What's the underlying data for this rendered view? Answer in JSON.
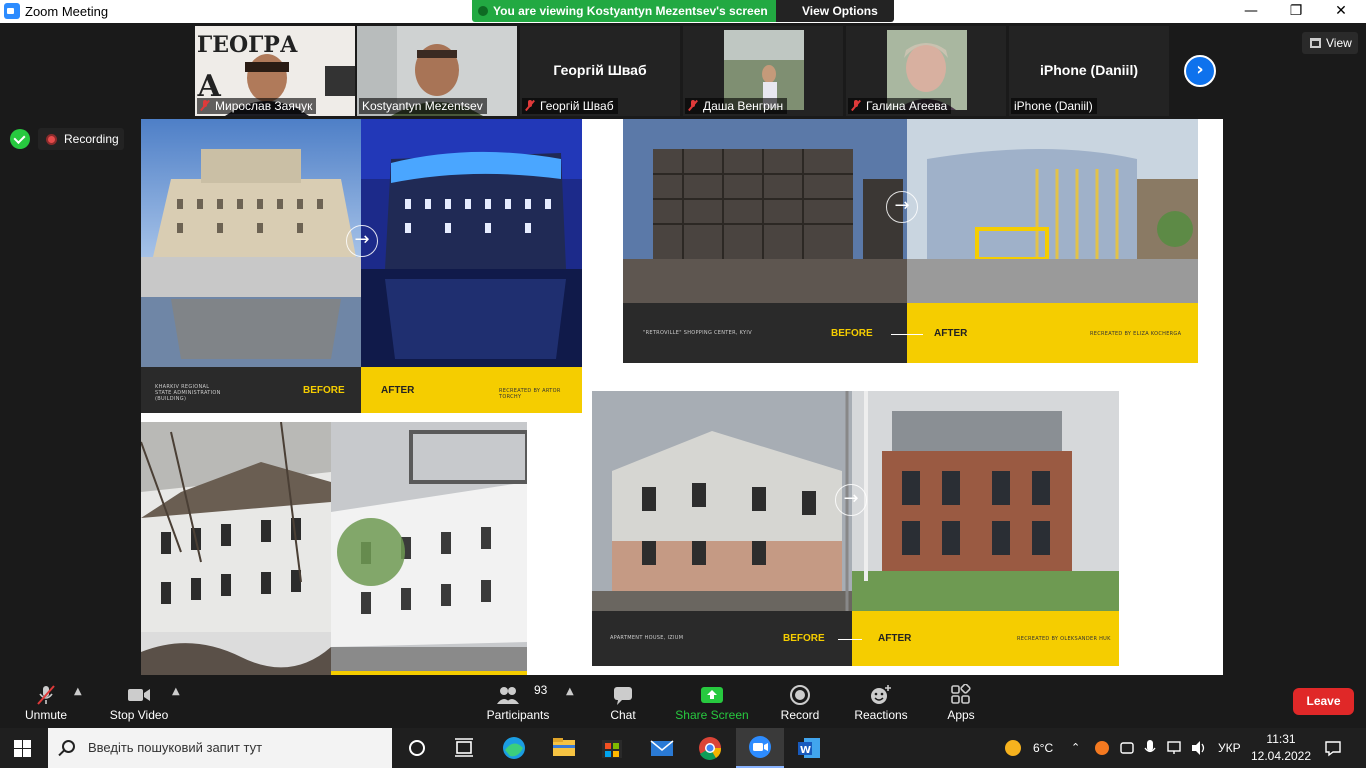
{
  "window": {
    "title": "Zoom Meeting"
  },
  "banner": {
    "message": "You are viewing Kostyantyn Mezentsev's screen",
    "view_options": "View Options"
  },
  "participants": [
    {
      "name": "Мирослав Заячук",
      "video": true,
      "muted": true
    },
    {
      "name": "Kostyantyn Mezentsev",
      "video": true,
      "muted": false,
      "active": true
    },
    {
      "name": "Георгій Шваб",
      "display_name": "Георгій Шваб",
      "video": false,
      "muted": true
    },
    {
      "name": "Даша Венгрин",
      "video": true,
      "muted": true
    },
    {
      "name": "Галина Агеева",
      "video": true,
      "muted": true
    },
    {
      "name": "iPhone (Daniil)",
      "display_name": "iPhone (Daniil)",
      "video": false,
      "muted": false
    }
  ],
  "view_button": "View",
  "recording": {
    "label": "Recording"
  },
  "slides": [
    {
      "place": "KHARKIV REGIONAL STATE ADMINISTRATION (BUILDING)",
      "before": "BEFORE",
      "after": "AFTER",
      "credit": "RECREATED BY ARTOR TORCHY"
    },
    {
      "place": "\"RETROVILLE\" SHOPPING CENTER, KYIV",
      "before": "BEFORE",
      "after": "AFTER",
      "credit": "RECREATED BY ELIZA KOCHERGA"
    },
    {
      "place": "APARTMENT HOUSE, IZIUM",
      "before": "BEFORE",
      "after": "AFTER",
      "credit": "RECREATED BY OLEKSANDER HUK"
    }
  ],
  "toolbar": {
    "unmute": "Unmute",
    "stop_video": "Stop Video",
    "participants": "Participants",
    "participants_count": "93",
    "chat": "Chat",
    "share_screen": "Share Screen",
    "record": "Record",
    "reactions": "Reactions",
    "apps": "Apps",
    "leave": "Leave"
  },
  "taskbar": {
    "search_placeholder": "Введіть пошуковий запит тут",
    "weather": "6°C",
    "language": "УКР",
    "time": "11:31",
    "date": "12.04.2022"
  },
  "colors": {
    "zoom_blue": "#0e72ed",
    "banner_green": "#22a942",
    "share_green": "#27c93f",
    "leave_red": "#e02828",
    "slide_yellow": "#f5cd00"
  }
}
